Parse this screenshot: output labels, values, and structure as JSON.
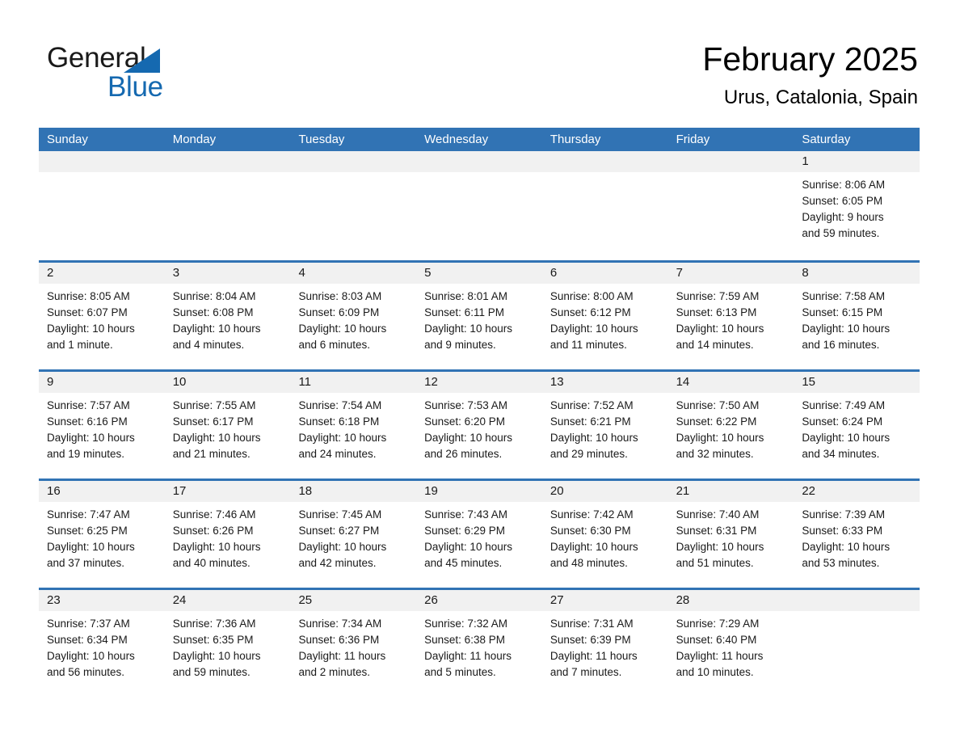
{
  "logo": {
    "word_one": "General",
    "word_two": "Blue",
    "triangle_icon": "triangle-icon",
    "blue": "#1569b0"
  },
  "header": {
    "title": "February 2025",
    "subtitle": "Urus, Catalonia, Spain"
  },
  "colors": {
    "header_blue": "#3173b4",
    "row_separator_blue": "#3173b4",
    "day_band_gray": "#f1f1f1",
    "text": "#1a1a1a",
    "background": "#ffffff"
  },
  "weekdays": [
    "Sunday",
    "Monday",
    "Tuesday",
    "Wednesday",
    "Thursday",
    "Friday",
    "Saturday"
  ],
  "weeks": [
    [
      {
        "day": "",
        "lines": []
      },
      {
        "day": "",
        "lines": []
      },
      {
        "day": "",
        "lines": []
      },
      {
        "day": "",
        "lines": []
      },
      {
        "day": "",
        "lines": []
      },
      {
        "day": "",
        "lines": []
      },
      {
        "day": "1",
        "lines": [
          "Sunrise: 8:06 AM",
          "Sunset: 6:05 PM",
          "Daylight: 9 hours",
          "and 59 minutes."
        ]
      }
    ],
    [
      {
        "day": "2",
        "lines": [
          "Sunrise: 8:05 AM",
          "Sunset: 6:07 PM",
          "Daylight: 10 hours",
          "and 1 minute."
        ]
      },
      {
        "day": "3",
        "lines": [
          "Sunrise: 8:04 AM",
          "Sunset: 6:08 PM",
          "Daylight: 10 hours",
          "and 4 minutes."
        ]
      },
      {
        "day": "4",
        "lines": [
          "Sunrise: 8:03 AM",
          "Sunset: 6:09 PM",
          "Daylight: 10 hours",
          "and 6 minutes."
        ]
      },
      {
        "day": "5",
        "lines": [
          "Sunrise: 8:01 AM",
          "Sunset: 6:11 PM",
          "Daylight: 10 hours",
          "and 9 minutes."
        ]
      },
      {
        "day": "6",
        "lines": [
          "Sunrise: 8:00 AM",
          "Sunset: 6:12 PM",
          "Daylight: 10 hours",
          "and 11 minutes."
        ]
      },
      {
        "day": "7",
        "lines": [
          "Sunrise: 7:59 AM",
          "Sunset: 6:13 PM",
          "Daylight: 10 hours",
          "and 14 minutes."
        ]
      },
      {
        "day": "8",
        "lines": [
          "Sunrise: 7:58 AM",
          "Sunset: 6:15 PM",
          "Daylight: 10 hours",
          "and 16 minutes."
        ]
      }
    ],
    [
      {
        "day": "9",
        "lines": [
          "Sunrise: 7:57 AM",
          "Sunset: 6:16 PM",
          "Daylight: 10 hours",
          "and 19 minutes."
        ]
      },
      {
        "day": "10",
        "lines": [
          "Sunrise: 7:55 AM",
          "Sunset: 6:17 PM",
          "Daylight: 10 hours",
          "and 21 minutes."
        ]
      },
      {
        "day": "11",
        "lines": [
          "Sunrise: 7:54 AM",
          "Sunset: 6:18 PM",
          "Daylight: 10 hours",
          "and 24 minutes."
        ]
      },
      {
        "day": "12",
        "lines": [
          "Sunrise: 7:53 AM",
          "Sunset: 6:20 PM",
          "Daylight: 10 hours",
          "and 26 minutes."
        ]
      },
      {
        "day": "13",
        "lines": [
          "Sunrise: 7:52 AM",
          "Sunset: 6:21 PM",
          "Daylight: 10 hours",
          "and 29 minutes."
        ]
      },
      {
        "day": "14",
        "lines": [
          "Sunrise: 7:50 AM",
          "Sunset: 6:22 PM",
          "Daylight: 10 hours",
          "and 32 minutes."
        ]
      },
      {
        "day": "15",
        "lines": [
          "Sunrise: 7:49 AM",
          "Sunset: 6:24 PM",
          "Daylight: 10 hours",
          "and 34 minutes."
        ]
      }
    ],
    [
      {
        "day": "16",
        "lines": [
          "Sunrise: 7:47 AM",
          "Sunset: 6:25 PM",
          "Daylight: 10 hours",
          "and 37 minutes."
        ]
      },
      {
        "day": "17",
        "lines": [
          "Sunrise: 7:46 AM",
          "Sunset: 6:26 PM",
          "Daylight: 10 hours",
          "and 40 minutes."
        ]
      },
      {
        "day": "18",
        "lines": [
          "Sunrise: 7:45 AM",
          "Sunset: 6:27 PM",
          "Daylight: 10 hours",
          "and 42 minutes."
        ]
      },
      {
        "day": "19",
        "lines": [
          "Sunrise: 7:43 AM",
          "Sunset: 6:29 PM",
          "Daylight: 10 hours",
          "and 45 minutes."
        ]
      },
      {
        "day": "20",
        "lines": [
          "Sunrise: 7:42 AM",
          "Sunset: 6:30 PM",
          "Daylight: 10 hours",
          "and 48 minutes."
        ]
      },
      {
        "day": "21",
        "lines": [
          "Sunrise: 7:40 AM",
          "Sunset: 6:31 PM",
          "Daylight: 10 hours",
          "and 51 minutes."
        ]
      },
      {
        "day": "22",
        "lines": [
          "Sunrise: 7:39 AM",
          "Sunset: 6:33 PM",
          "Daylight: 10 hours",
          "and 53 minutes."
        ]
      }
    ],
    [
      {
        "day": "23",
        "lines": [
          "Sunrise: 7:37 AM",
          "Sunset: 6:34 PM",
          "Daylight: 10 hours",
          "and 56 minutes."
        ]
      },
      {
        "day": "24",
        "lines": [
          "Sunrise: 7:36 AM",
          "Sunset: 6:35 PM",
          "Daylight: 10 hours",
          "and 59 minutes."
        ]
      },
      {
        "day": "25",
        "lines": [
          "Sunrise: 7:34 AM",
          "Sunset: 6:36 PM",
          "Daylight: 11 hours",
          "and 2 minutes."
        ]
      },
      {
        "day": "26",
        "lines": [
          "Sunrise: 7:32 AM",
          "Sunset: 6:38 PM",
          "Daylight: 11 hours",
          "and 5 minutes."
        ]
      },
      {
        "day": "27",
        "lines": [
          "Sunrise: 7:31 AM",
          "Sunset: 6:39 PM",
          "Daylight: 11 hours",
          "and 7 minutes."
        ]
      },
      {
        "day": "28",
        "lines": [
          "Sunrise: 7:29 AM",
          "Sunset: 6:40 PM",
          "Daylight: 11 hours",
          "and 10 minutes."
        ]
      },
      {
        "day": "",
        "lines": []
      }
    ]
  ]
}
